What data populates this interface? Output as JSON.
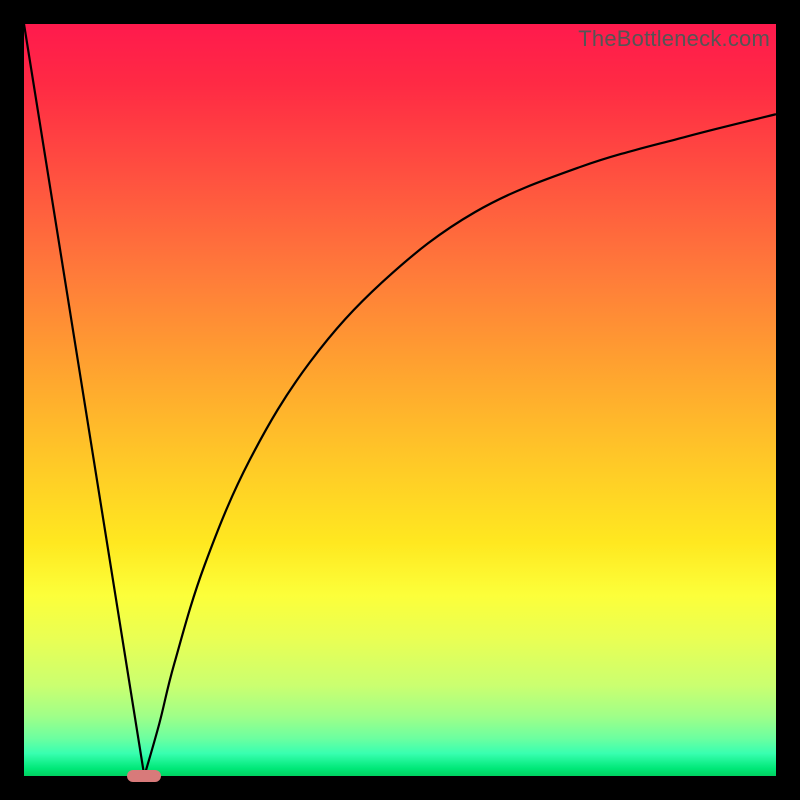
{
  "watermark": "TheBottleneck.com",
  "chart_data": {
    "type": "line",
    "title": "",
    "xlabel": "",
    "ylabel": "",
    "xlim": [
      0,
      100
    ],
    "ylim": [
      0,
      100
    ],
    "background_gradient": {
      "top_color": "#ff1a4d",
      "bottom_color": "#00d060",
      "meaning": "red=high bottleneck, green=low bottleneck"
    },
    "series": [
      {
        "name": "left-branch",
        "x": [
          0,
          16
        ],
        "values": [
          100,
          0
        ]
      },
      {
        "name": "right-branch",
        "x": [
          16,
          18,
          20,
          24,
          30,
          38,
          48,
          60,
          74,
          88,
          100
        ],
        "values": [
          0,
          7,
          15,
          28,
          42,
          55,
          66,
          75,
          81,
          85,
          88
        ]
      }
    ],
    "annotations": [
      {
        "name": "optimal-marker",
        "x": 16,
        "y": 0,
        "shape": "pill",
        "color": "#d87a7a"
      }
    ],
    "grid": false,
    "legend": false
  },
  "plot": {
    "inner_width": 752,
    "inner_height": 752
  }
}
